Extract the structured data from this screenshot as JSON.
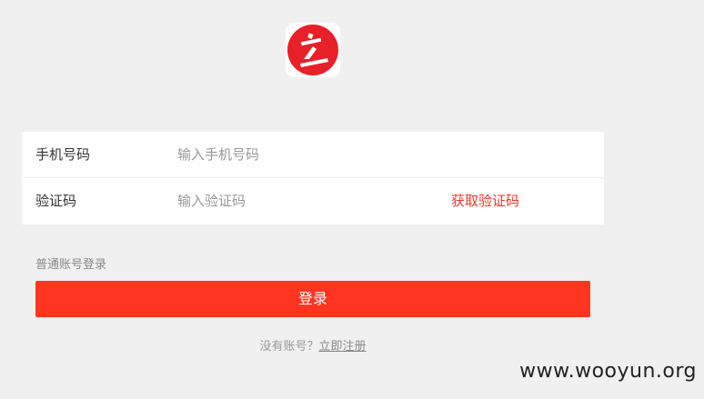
{
  "app": {
    "logo_name": "app-logo"
  },
  "form": {
    "phone": {
      "label": "手机号码",
      "placeholder": "输入手机号码",
      "value": ""
    },
    "code": {
      "label": "验证码",
      "placeholder": "输入验证码",
      "value": "",
      "get_code_label": "获取验证码"
    }
  },
  "normal_login_label": "普通账号登录",
  "login_button_label": "登录",
  "register": {
    "prompt": "没有账号？",
    "link_label": "立即注册"
  },
  "watermark": "www.wooyun.org",
  "colors": {
    "accent": "#ff3522",
    "link_red": "#e8382b",
    "background": "#f0f0f0"
  }
}
